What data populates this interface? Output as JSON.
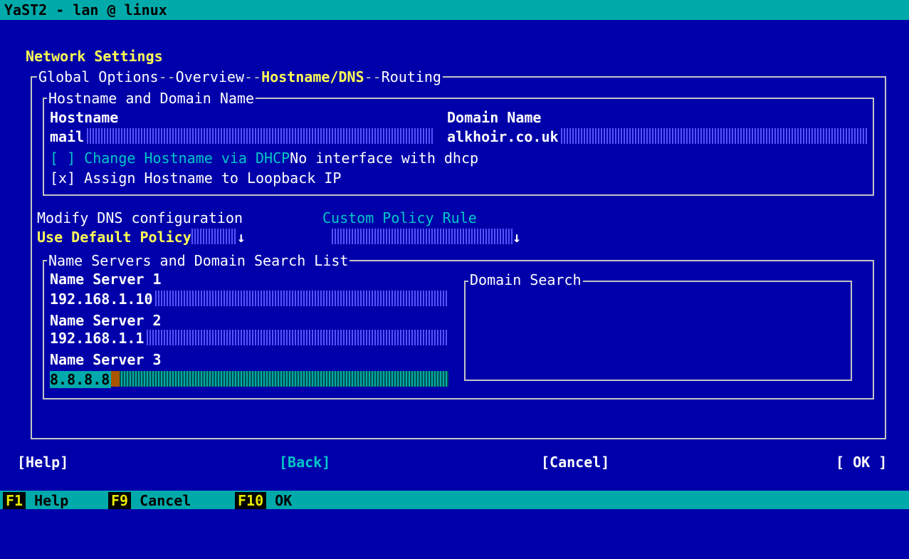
{
  "window": {
    "title": "YaST2 - lan @ linux"
  },
  "page": {
    "title": "Network Settings"
  },
  "tabs": [
    "Global Options",
    "Overview",
    "Hostname/DNS",
    "Routing"
  ],
  "active_tab": "Hostname/DNS",
  "hostname_group": {
    "legend": "Hostname and Domain Name",
    "hostname_label": "Hostname",
    "hostname_value": "mail",
    "domain_label": "Domain Name",
    "domain_value": "alkhoir.co.uk",
    "dhcp_checkbox": {
      "mark": "[ ]",
      "label": "Change Hostname via DHCP",
      "checked": false
    },
    "dhcp_note": "No interface with dhcp",
    "loopback_checkbox": {
      "mark": "[x]",
      "label": "Assign Hostname to Loopback IP",
      "checked": true
    }
  },
  "dns": {
    "modify_label": "Modify DNS configuration",
    "policy_label": "Custom Policy Rule",
    "modify_value": "Use Default Policy",
    "policy_value": "",
    "arrow": "↓"
  },
  "nameservers_group": {
    "legend": "Name Servers and Domain Search List",
    "ns1_label": "Name Server 1",
    "ns1_value": "192.168.1.10",
    "ns2_label": "Name Server 2",
    "ns2_value": "192.168.1.1",
    "ns3_label": "Name Server 3",
    "ns3_value": "8.8.8.8",
    "domain_search_legend": "Domain Search"
  },
  "buttons": {
    "help": "[Help]",
    "back": "[Back]",
    "cancel": "[Cancel]",
    "ok": "[ OK ]"
  },
  "function_keys": [
    {
      "key": "F1",
      "label": "Help"
    },
    {
      "key": "F9",
      "label": "Cancel"
    },
    {
      "key": "F10",
      "label": "OK"
    }
  ],
  "colors": {
    "background": "#0000aa",
    "titlebar": "#00aaaa",
    "highlight": "#ffff55",
    "accent": "#00c8c8"
  }
}
